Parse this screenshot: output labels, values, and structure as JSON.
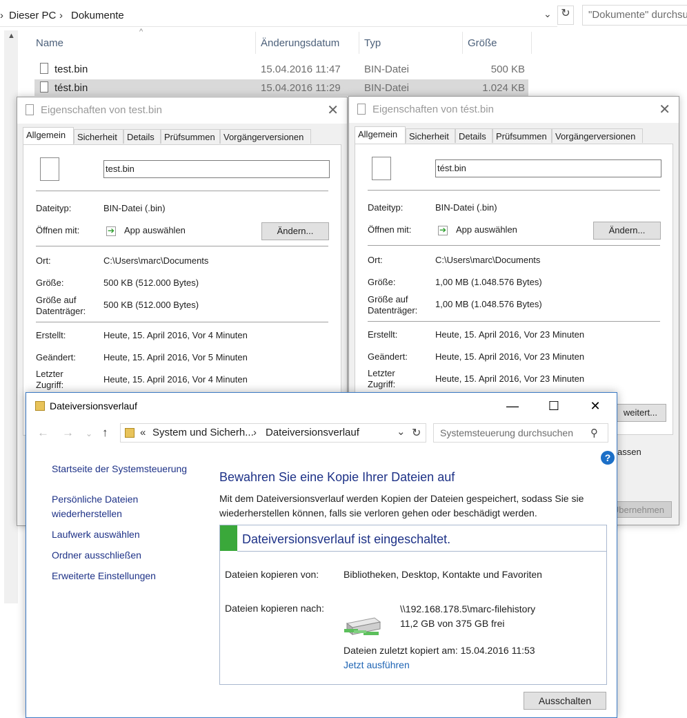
{
  "explorer": {
    "breadcrumb": [
      "Dieser PC",
      "Dokumente"
    ],
    "search_placeholder": "\"Dokumente\" durchsuchen",
    "columns": [
      "Name",
      "Änderungsdatum",
      "Typ",
      "Größe"
    ],
    "files": [
      {
        "name": "test.bin",
        "date": "15.04.2016 11:47",
        "type": "BIN-Datei",
        "size": "500 KB",
        "selected": false
      },
      {
        "name": "tést.bin",
        "date": "15.04.2016 11:29",
        "type": "BIN-Datei",
        "size": "1.024 KB",
        "selected": true
      }
    ]
  },
  "dialog_left": {
    "title": "Eigenschaften von test.bin",
    "tabs": [
      "Allgemein",
      "Sicherheit",
      "Details",
      "Prüfsummen",
      "Vorgängerversionen"
    ],
    "filename": "test.bin",
    "filetype_label": "Dateityp:",
    "filetype": "BIN-Datei (.bin)",
    "openwith_label": "Öffnen mit:",
    "openwith": "App auswählen",
    "change_button": "Ändern...",
    "location_label": "Ort:",
    "location": "C:\\Users\\marc\\Documents",
    "size_label": "Größe:",
    "size": "500 KB (512.000 Bytes)",
    "disk_size_label": "Größe auf Datenträger:",
    "disk_size": "500 KB (512.000 Bytes)",
    "created_label": "Erstellt:",
    "created": "Heute, 15. April 2016, Vor 4 Minuten",
    "modified_label": "Geändert:",
    "modified": "Heute, 15. April 2016, Vor 5 Minuten",
    "accessed_label": "Letzter Zugriff:",
    "accessed": "Heute, 15. April 2016, Vor 4 Minuten"
  },
  "dialog_right": {
    "title": "Eigenschaften von tést.bin",
    "tabs": [
      "Allgemein",
      "Sicherheit",
      "Details",
      "Prüfsummen",
      "Vorgängerversionen"
    ],
    "filename": "tést.bin",
    "filetype_label": "Dateityp:",
    "filetype": "BIN-Datei (.bin)",
    "openwith_label": "Öffnen mit:",
    "openwith": "App auswählen",
    "change_button": "Ändern...",
    "location_label": "Ort:",
    "location": "C:\\Users\\marc\\Documents",
    "size_label": "Größe:",
    "size": "1,00 MB (1.048.576 Bytes)",
    "disk_size_label": "Größe auf Datenträger:",
    "disk_size": "1,00 MB (1.048.576 Bytes)",
    "created_label": "Erstellt:",
    "created": "Heute, 15. April 2016, Vor 23 Minuten",
    "modified_label": "Geändert:",
    "modified": "Heute, 15. April 2016, Vor 23 Minuten",
    "accessed_label": "Letzter Zugriff:",
    "accessed": "Heute, 15. April 2016, Vor 23 Minuten",
    "partial_advanced": "weitert...",
    "partial_text": "assen",
    "partial_apply": "Übernehmen"
  },
  "file_history": {
    "title": "Dateiversionsverlauf",
    "address_prefix": "«",
    "address": [
      "System und Sicherh...",
      "Dateiversionsverlauf"
    ],
    "search_placeholder": "Systemsteuerung durchsuchen",
    "left_links": [
      "Startseite der Systemsteuerung",
      "Persönliche Dateien wiederherstellen",
      "Laufwerk auswählen",
      "Ordner ausschließen",
      "Erweiterte Einstellungen"
    ],
    "heading": "Bewahren Sie eine Kopie Ihrer Dateien auf",
    "description": "Mit dem Dateiversionsverlauf werden Kopien der Dateien gespeichert, sodass Sie sie wiederherstellen können, falls sie verloren gehen oder beschädigt werden.",
    "status": "Dateiversionsverlauf ist eingeschaltet.",
    "copy_from_label": "Dateien kopieren von:",
    "copy_from": "Bibliotheken, Desktop, Kontakte und Favoriten",
    "copy_to_label": "Dateien kopieren nach:",
    "target_path": "\\\\192.168.178.5\\marc-filehistory",
    "target_space": "11,2 GB von 375 GB frei",
    "last_copied": "Dateien zuletzt kopiert am: 15.04.2016 11:53",
    "run_now": "Jetzt ausführen",
    "turn_off": "Ausschalten"
  },
  "icons": [
    "file-icon",
    "app-icon",
    "file-history-icon",
    "nas-drive-icon",
    "help-icon",
    "close-icon",
    "refresh-icon",
    "search-icon"
  ]
}
